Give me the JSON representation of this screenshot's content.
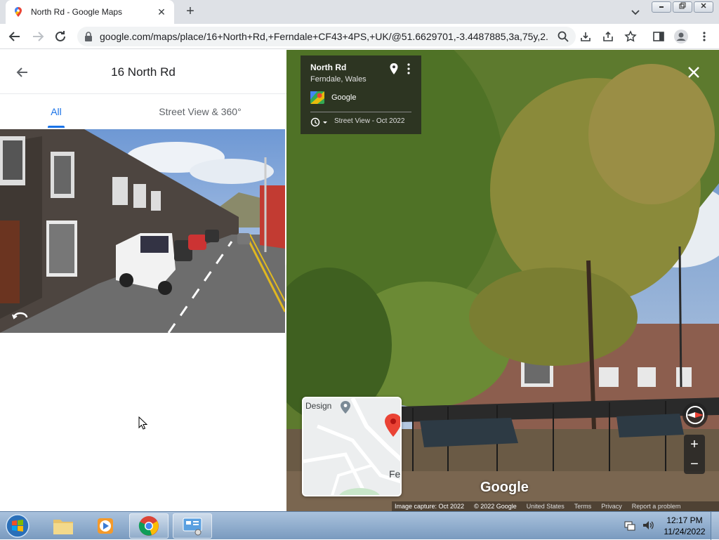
{
  "browser": {
    "tab_title": "North Rd - Google Maps",
    "tab_close": "✕",
    "new_tab": "+",
    "url": "google.com/maps/place/16+North+Rd,+Ferndale+CF43+4PS,+UK/@51.6629701,-3.4487885,3a,75y,2..."
  },
  "panel": {
    "title": "16 North Rd",
    "tabs": [
      {
        "label": "All",
        "selected": true
      },
      {
        "label": "Street View & 360°",
        "selected": false
      }
    ]
  },
  "streetview": {
    "road": "North Rd",
    "town": "Ferndale, Wales",
    "source": "Google",
    "date": "Street View - Oct 2022",
    "logo": "Google",
    "minimap": {
      "label_design": "Design",
      "label_fe": "Fe"
    },
    "zoom_in": "+",
    "zoom_out": "−",
    "attribution": {
      "capture": "Image capture: Oct 2022",
      "copyright": "© 2022 Google",
      "country": "United States",
      "terms": "Terms",
      "privacy": "Privacy",
      "report": "Report a problem"
    }
  },
  "taskbar": {
    "time": "12:17 PM",
    "date": "11/24/2022"
  }
}
